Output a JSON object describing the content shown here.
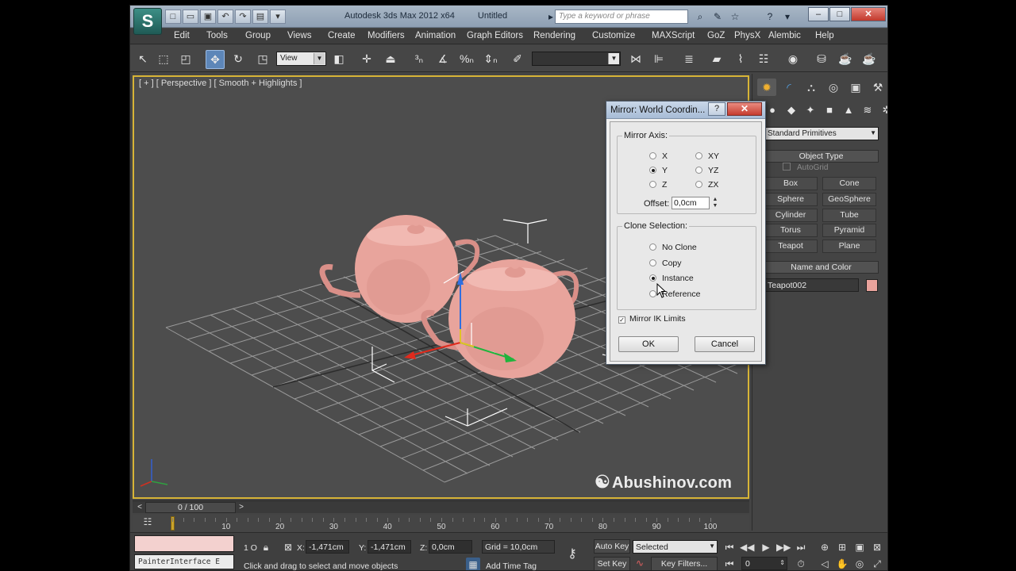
{
  "titlebar": {
    "app_name": "Autodesk 3ds Max  2012 x64",
    "doc_name": "Untitled",
    "search_placeholder": "Type a keyword or phrase",
    "logo_icon": "3ds-max-logo-icon"
  },
  "menu": [
    "Edit",
    "Tools",
    "Group",
    "Views",
    "Create",
    "Modifiers",
    "Animation",
    "Graph Editors",
    "Rendering",
    "Customize",
    "MAXScript",
    "GoZ",
    "PhysX",
    "Alembic",
    "Help"
  ],
  "toolbar": {
    "reference_coord": "View",
    "named_selection": ""
  },
  "viewport": {
    "label": "[ + ] [ Perspective ] [ Smooth + Highlights ]",
    "watermark": "Abushinov.com",
    "teapot_color": "#e8a49c"
  },
  "command_panel": {
    "category": "Standard Primitives",
    "object_type_title": "Object Type",
    "autogrid": "AutoGrid",
    "buttons": [
      "Box",
      "Cone",
      "Sphere",
      "GeoSphere",
      "Cylinder",
      "Tube",
      "Torus",
      "Pyramid",
      "Teapot",
      "Plane"
    ],
    "name_color_title": "Name and Color",
    "object_name": "Teapot002",
    "object_color": "#e9a39c"
  },
  "dialog": {
    "title": "Mirror: World Coordin...",
    "mirror_axis_label": "Mirror Axis:",
    "axes": [
      {
        "label": "X",
        "selected": false
      },
      {
        "label": "XY",
        "selected": false
      },
      {
        "label": "Y",
        "selected": true
      },
      {
        "label": "YZ",
        "selected": false
      },
      {
        "label": "Z",
        "selected": false
      },
      {
        "label": "ZX",
        "selected": false
      }
    ],
    "offset_label": "Offset:",
    "offset_value": "0,0cm",
    "clone_label": "Clone Selection:",
    "clone_options": [
      {
        "label": "No Clone",
        "selected": false
      },
      {
        "label": "Copy",
        "selected": false
      },
      {
        "label": "Instance",
        "selected": true
      },
      {
        "label": "Reference",
        "selected": false
      }
    ],
    "mirror_ik_label": "Mirror IK Limits",
    "mirror_ik_checked": true,
    "ok_label": "OK",
    "cancel_label": "Cancel"
  },
  "time_slider": {
    "position": "0 / 100",
    "current_frame": 0,
    "total_frames": 100,
    "ticks": [
      "10",
      "20",
      "30",
      "40",
      "50",
      "60",
      "70",
      "80",
      "90",
      "100"
    ]
  },
  "status": {
    "painter_text": "PainterInterface E",
    "selection_count": "1 O",
    "x_label": "X:",
    "x_value": "-1,471cm",
    "y_label": "Y:",
    "y_value": "-1,471cm",
    "z_label": "Z:",
    "z_value": "0,0cm",
    "grid": "Grid = 10,0cm",
    "prompt": "Click and drag to select and move objects",
    "add_time_tag": "Add Time Tag",
    "auto_key": "Auto Key",
    "set_key": "Set Key",
    "selected_filter": "Selected",
    "key_filters": "Key Filters...",
    "frame_value": "0"
  }
}
